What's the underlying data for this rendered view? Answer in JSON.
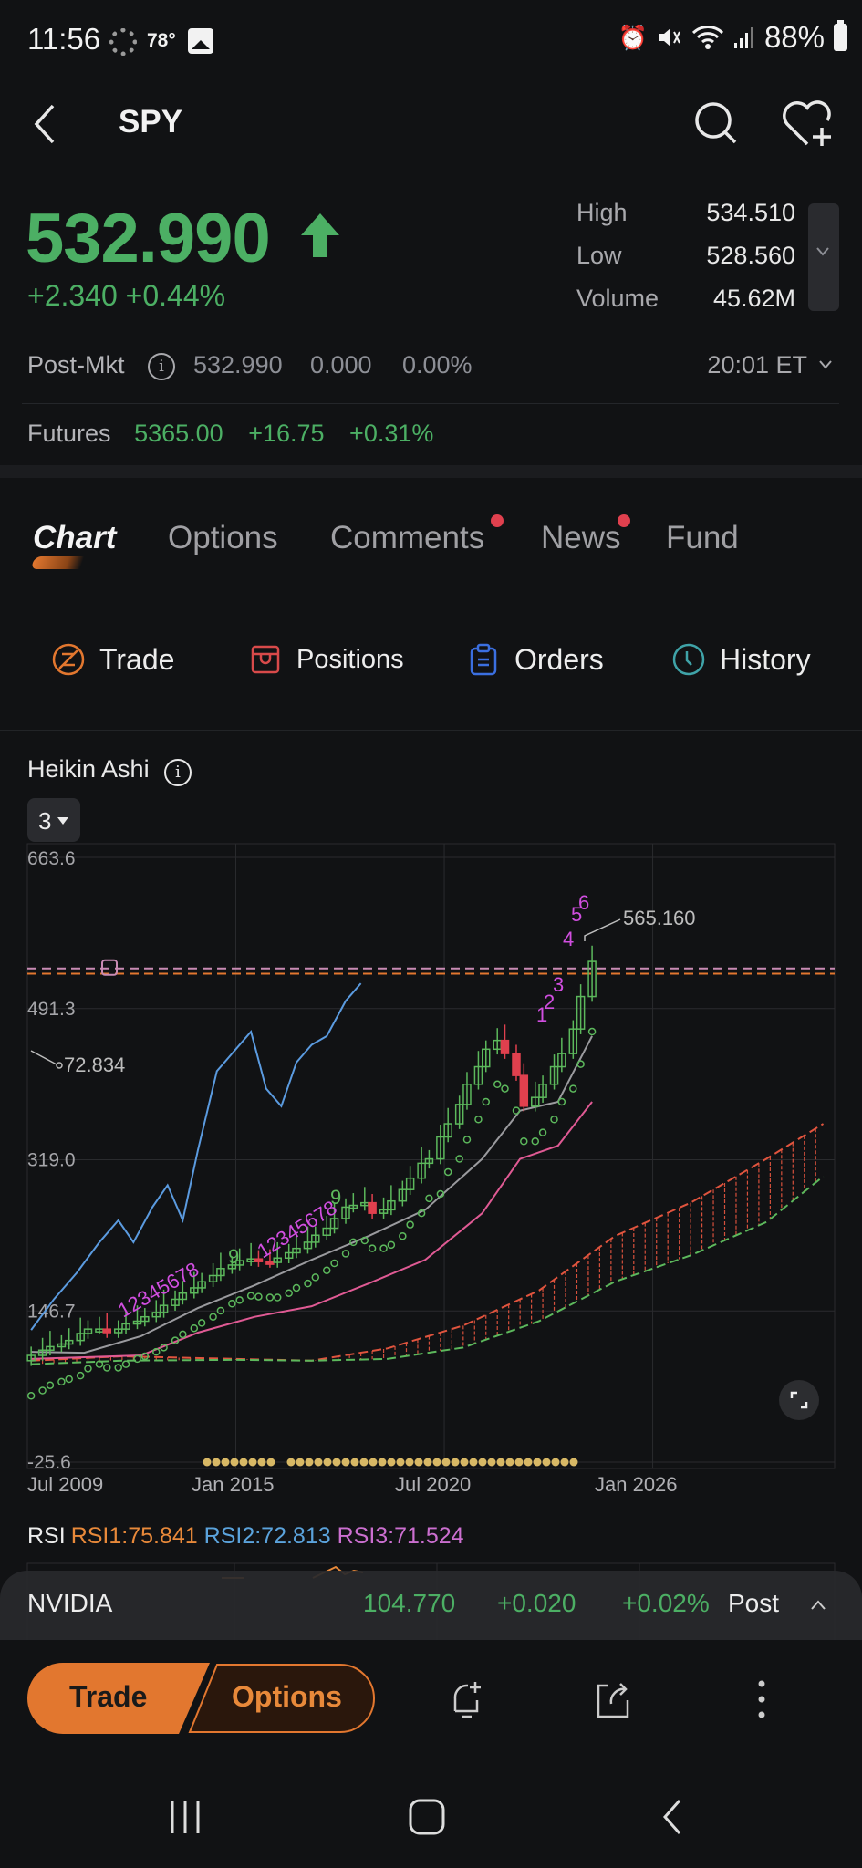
{
  "status_bar": {
    "time": "11:56",
    "temperature": "78°",
    "battery": "88%",
    "icons": [
      "weather-icon",
      "gallery-icon",
      "alarm-icon",
      "mute-icon",
      "wifi-icon",
      "signal-icon",
      "battery-icon"
    ]
  },
  "header": {
    "title": "SPY",
    "back_icon": "back-chevron-icon",
    "search_icon": "search-icon",
    "watchlist_icon": "heart-plus-icon"
  },
  "quote": {
    "price": "532.990",
    "direction": "up",
    "change": "+2.340",
    "change_pct": "+0.44%",
    "stats": [
      {
        "label": "High",
        "value": "534.510"
      },
      {
        "label": "Low",
        "value": "528.560"
      },
      {
        "label": "Volume",
        "value": "45.62M"
      }
    ],
    "post_market": {
      "label": "Post-Mkt",
      "price": "532.990",
      "change": "0.000",
      "change_pct": "0.00%",
      "time": "20:01 ET"
    },
    "futures": {
      "label": "Futures",
      "price": "5365.00",
      "change": "+16.75",
      "change_pct": "+0.31%"
    }
  },
  "tabs": [
    {
      "label": "Chart",
      "active": true,
      "badge": false
    },
    {
      "label": "Options",
      "active": false,
      "badge": false
    },
    {
      "label": "Comments",
      "active": false,
      "badge": true
    },
    {
      "label": "News",
      "active": false,
      "badge": true
    },
    {
      "label": "Fund",
      "active": false,
      "badge": false
    }
  ],
  "actions": [
    {
      "label": "Trade",
      "icon": "trade-icon",
      "color": "#e2772f"
    },
    {
      "label": "Positions",
      "icon": "positions-icon",
      "color": "#d84a4a"
    },
    {
      "label": "Orders",
      "icon": "orders-icon",
      "color": "#3b6fe0"
    },
    {
      "label": "History",
      "icon": "history-clock-icon",
      "color": "#3fa3a8"
    }
  ],
  "chart": {
    "type_label": "Heikin Ashi",
    "period": "3",
    "last_high_label": "565.160",
    "low_label": "72.834"
  },
  "colors": {
    "up": "#4caf64",
    "down": "#e0404e",
    "accent": "#e2772f",
    "background": "#111214"
  },
  "chart_data": {
    "type": "line",
    "title": "Heikin Ashi",
    "xlabel": "",
    "ylabel": "",
    "x_ticks": [
      "Jul 2009",
      "Jan 2015",
      "Jul 2020",
      "Jan 2026"
    ],
    "y_ticks": [
      663.6,
      491.3,
      319.0,
      146.7,
      -25.6
    ],
    "ylim": [
      -25.6,
      663.6
    ],
    "xlim": [
      "Jul 2009",
      "Dec 2030"
    ],
    "grid": true,
    "annotations": [
      {
        "text": "565.160",
        "kind": "high-marker"
      },
      {
        "text": "72.834",
        "kind": "low-marker"
      },
      {
        "text": "123456789",
        "kind": "td-sequence",
        "near": "2012"
      },
      {
        "text": "123456789",
        "kind": "td-sequence",
        "near": "2016"
      },
      {
        "text": "123456",
        "kind": "td-sequence",
        "near": "2024"
      }
    ],
    "reference_lines": [
      {
        "name": "pink-dashed",
        "value": 537,
        "color": "#c98bb4"
      },
      {
        "name": "orange-dashed",
        "value": 531,
        "color": "#e2772f"
      }
    ],
    "series": [
      {
        "name": "Heikin Ashi (quarterly)",
        "type": "candlestick",
        "x": [
          2009.6,
          2009.9,
          2010.1,
          2010.4,
          2010.6,
          2010.9,
          2011.1,
          2011.4,
          2011.6,
          2011.9,
          2012.1,
          2012.4,
          2012.6,
          2012.9,
          2013.1,
          2013.4,
          2013.6,
          2013.9,
          2014.1,
          2014.4,
          2014.6,
          2014.9,
          2015.1,
          2015.4,
          2015.6,
          2015.9,
          2016.1,
          2016.4,
          2016.6,
          2016.9,
          2017.1,
          2017.4,
          2017.6,
          2017.9,
          2018.1,
          2018.4,
          2018.6,
          2018.9,
          2019.1,
          2019.4,
          2019.6,
          2019.9,
          2020.1,
          2020.4,
          2020.6,
          2020.9,
          2021.1,
          2021.4,
          2021.6,
          2021.9,
          2022.1,
          2022.4,
          2022.6,
          2022.9,
          2023.1,
          2023.4,
          2023.6,
          2023.9,
          2024.1,
          2024.4
        ],
        "open": [
          90,
          96,
          102,
          106,
          109,
          113,
          121,
          126,
          126,
          122,
          126,
          132,
          135,
          140,
          145,
          153,
          160,
          167,
          173,
          180,
          187,
          195,
          199,
          204,
          206,
          203,
          202,
          207,
          213,
          218,
          225,
          233,
          241,
          252,
          265,
          267,
          270,
          258,
          262,
          272,
          285,
          298,
          315,
          320,
          345,
          360,
          382,
          405,
          425,
          445,
          455,
          440,
          415,
          380,
          390,
          405,
          425,
          440,
          468,
          505
        ],
        "close": [
          96,
          102,
          106,
          109,
          113,
          121,
          126,
          126,
          122,
          126,
          132,
          135,
          140,
          145,
          153,
          160,
          167,
          173,
          180,
          187,
          195,
          199,
          204,
          206,
          203,
          202,
          207,
          213,
          218,
          225,
          233,
          241,
          252,
          265,
          267,
          270,
          258,
          262,
          272,
          285,
          298,
          315,
          320,
          345,
          360,
          382,
          405,
          425,
          445,
          455,
          440,
          415,
          380,
          390,
          405,
          425,
          440,
          468,
          505,
          545
        ],
        "color_note": "green=up, red=down"
      },
      {
        "name": "Blue comparison line",
        "color": "#5b9be0",
        "x": [
          2009.6,
          2010.2,
          2010.8,
          2011.4,
          2011.9,
          2012.3,
          2012.8,
          2013.2,
          2013.6,
          2014.0,
          2014.5,
          2015.0,
          2015.4,
          2015.8,
          2016.2,
          2016.6,
          2017.0,
          2017.4,
          2017.9,
          2018.3
        ],
        "y": [
          125,
          160,
          190,
          225,
          250,
          225,
          265,
          290,
          250,
          330,
          420,
          445,
          465,
          400,
          380,
          430,
          450,
          460,
          500,
          520
        ]
      },
      {
        "name": "Gray moving average",
        "color": "#9a9a9e",
        "x": [
          2009.6,
          2011,
          2012.5,
          2014,
          2015.5,
          2017,
          2018.5,
          2020,
          2021.5,
          2022.5,
          2023.5,
          2024.4
        ],
        "y": [
          100,
          99,
          118,
          150,
          176,
          205,
          232,
          262,
          320,
          375,
          385,
          460
        ]
      },
      {
        "name": "Pink moving average",
        "color": "#e05a94",
        "x": [
          2009.6,
          2011,
          2012.5,
          2014,
          2015.5,
          2017,
          2018.5,
          2020,
          2021.5,
          2022.5,
          2023.5,
          2024.4
        ],
        "y": [
          92,
          94,
          96,
          122,
          140,
          152,
          178,
          205,
          258,
          320,
          335,
          385
        ]
      },
      {
        "name": "Ichimoku cloud upper (red)",
        "color": "#e0543e",
        "x": [
          2009.6,
          2012,
          2015,
          2017,
          2019,
          2021,
          2023,
          2025,
          2027,
          2029,
          2030.5
        ],
        "y": [
          90,
          95,
          92,
          90,
          104,
          130,
          170,
          232,
          270,
          320,
          360
        ]
      },
      {
        "name": "Ichimoku cloud lower (green)",
        "color": "#5cb85c",
        "x": [
          2009.6,
          2012,
          2015,
          2017,
          2019,
          2021,
          2023,
          2025,
          2027,
          2029,
          2030.5
        ],
        "y": [
          86,
          90,
          91,
          90,
          92,
          105,
          135,
          180,
          210,
          248,
          300
        ]
      }
    ]
  },
  "rsi": {
    "label": "RSI",
    "rsi1": "RSI1:75.841",
    "rsi2": "RSI2:72.813",
    "rsi3": "RSI3:71.524"
  },
  "mini_ticker": {
    "name": "NVIDIA",
    "price": "104.770",
    "change": "+0.020",
    "change_pct": "+0.02%",
    "session": "Post"
  },
  "bottom_bar": {
    "trade_label": "Trade",
    "options_label": "Options",
    "icons": [
      "add-alert-icon",
      "share-icon",
      "more-vertical-icon"
    ]
  }
}
